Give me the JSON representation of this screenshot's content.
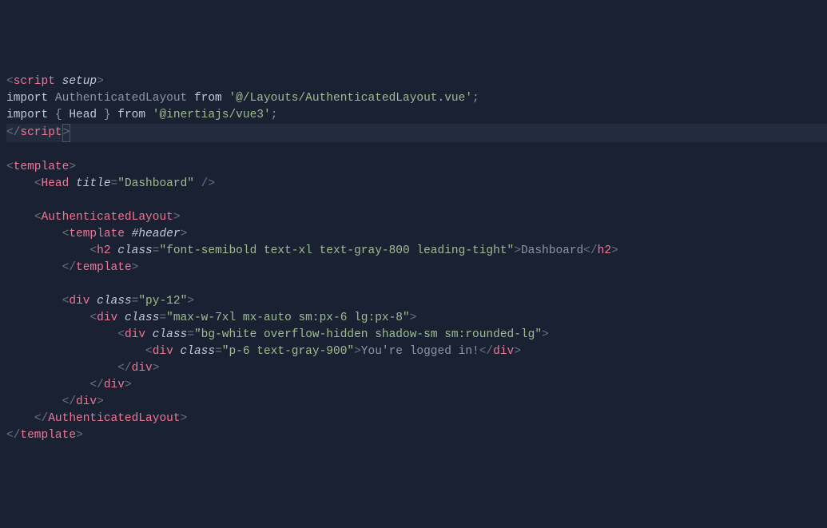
{
  "code": {
    "l1": {
      "tag_open": "<",
      "tag_name": "script",
      "attr": "setup",
      "tag_close": ">"
    },
    "l2": {
      "kw_import": "import",
      "ident": "AuthenticatedLayout",
      "kw_from": "from",
      "str": "'@/Layouts/AuthenticatedLayout.vue'",
      "semi": ";"
    },
    "l3": {
      "kw_import": "import",
      "brace_l": "{",
      "ident": "Head",
      "brace_r": "}",
      "kw_from": "from",
      "str": "'@inertiajs/vue3'",
      "semi": ";"
    },
    "l4": {
      "tag_open": "</",
      "tag_name": "script",
      "tag_close": ">"
    },
    "l6": {
      "tag_open": "<",
      "tag_name": "template",
      "tag_close": ">"
    },
    "l7": {
      "indent": "    ",
      "tag_open": "<",
      "tag_name": "Head",
      "attr": "title",
      "eq": "=",
      "val": "\"Dashboard\"",
      "selfclose": " />"
    },
    "l9": {
      "indent": "    ",
      "tag_open": "<",
      "tag_name": "AuthenticatedLayout",
      "tag_close": ">"
    },
    "l10": {
      "indent": "        ",
      "tag_open": "<",
      "tag_name": "template",
      "attr": "#header",
      "tag_close": ">"
    },
    "l11": {
      "indent": "            ",
      "tag_open": "<",
      "tag_name": "h2",
      "attr": "class",
      "eq": "=",
      "val": "\"font-semibold text-xl text-gray-800 leading-tight\"",
      "tag_close": ">",
      "text": "Dashboard",
      "ctag_open": "</",
      "ctag_name": "h2",
      "ctag_close": ">"
    },
    "l12": {
      "indent": "        ",
      "tag_open": "</",
      "tag_name": "template",
      "tag_close": ">"
    },
    "l14": {
      "indent": "        ",
      "tag_open": "<",
      "tag_name": "div",
      "attr": "class",
      "eq": "=",
      "val": "\"py-12\"",
      "tag_close": ">"
    },
    "l15": {
      "indent": "            ",
      "tag_open": "<",
      "tag_name": "div",
      "attr": "class",
      "eq": "=",
      "val": "\"max-w-7xl mx-auto sm:px-6 lg:px-8\"",
      "tag_close": ">"
    },
    "l16": {
      "indent": "                ",
      "tag_open": "<",
      "tag_name": "div",
      "attr": "class",
      "eq": "=",
      "val": "\"bg-white overflow-hidden shadow-sm sm:rounded-lg\"",
      "tag_close": ">"
    },
    "l17": {
      "indent": "                    ",
      "tag_open": "<",
      "tag_name": "div",
      "attr": "class",
      "eq": "=",
      "val": "\"p-6 text-gray-900\"",
      "tag_close": ">",
      "text": "You're logged in!",
      "ctag_open": "</",
      "ctag_name": "div",
      "ctag_close": ">"
    },
    "l18": {
      "indent": "                ",
      "tag_open": "</",
      "tag_name": "div",
      "tag_close": ">"
    },
    "l19": {
      "indent": "            ",
      "tag_open": "</",
      "tag_name": "div",
      "tag_close": ">"
    },
    "l20": {
      "indent": "        ",
      "tag_open": "</",
      "tag_name": "div",
      "tag_close": ">"
    },
    "l21": {
      "indent": "    ",
      "tag_open": "</",
      "tag_name": "AuthenticatedLayout",
      "tag_close": ">"
    },
    "l22": {
      "tag_open": "</",
      "tag_name": "template",
      "tag_close": ">"
    }
  }
}
